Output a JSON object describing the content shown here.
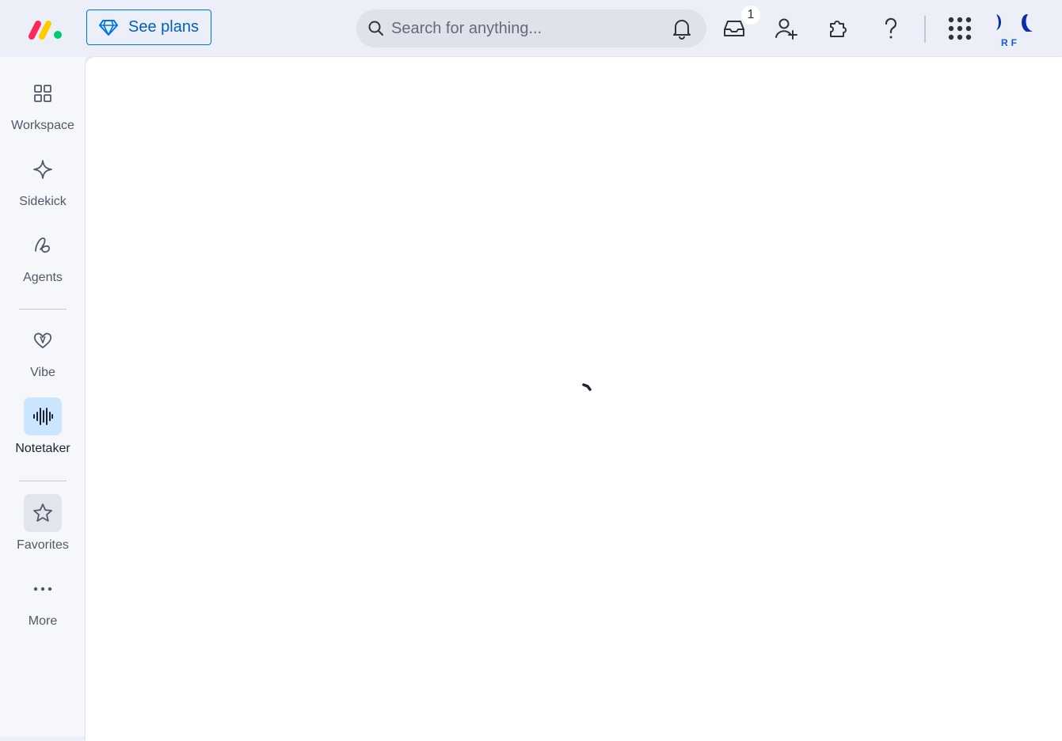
{
  "header": {
    "upgrade_label": "See plans",
    "search": {
      "placeholder": "Search for anything..."
    },
    "inbox_badge": "1",
    "avatar_initials": "RF",
    "icons": [
      "bell-icon",
      "inbox-icon",
      "invite-members-icon",
      "apps-marketplace-icon",
      "help-icon",
      "app-switcher-icon"
    ]
  },
  "sidebar": {
    "items": [
      {
        "label": "Workspace",
        "icon": "grid-icon"
      },
      {
        "label": "Sidekick",
        "icon": "sparkle-icon"
      },
      {
        "label": "Agents",
        "icon": "agents-icon"
      },
      {
        "label": "Vibe",
        "icon": "heart-icon"
      },
      {
        "label": "Notetaker",
        "icon": "soundwave-icon",
        "active": true
      },
      {
        "label": "Favorites",
        "icon": "star-icon"
      },
      {
        "label": "More",
        "icon": "more-icon"
      }
    ]
  },
  "colors": {
    "accent": "#0073ea",
    "active_bg": "#cce5ff",
    "logo_red": "#fb275d",
    "logo_yellow": "#ffcb00",
    "logo_green": "#00ca72",
    "avatar_blue": "#0a2ea8"
  },
  "main": {
    "state": "loading"
  }
}
